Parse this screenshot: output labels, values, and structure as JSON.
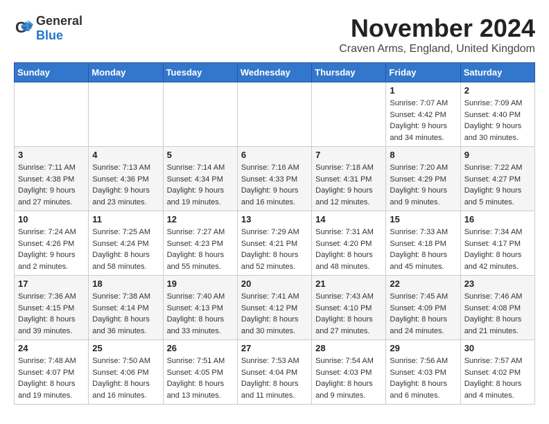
{
  "header": {
    "logo_general": "General",
    "logo_blue": "Blue",
    "month_title": "November 2024",
    "location": "Craven Arms, England, United Kingdom"
  },
  "weekdays": [
    "Sunday",
    "Monday",
    "Tuesday",
    "Wednesday",
    "Thursday",
    "Friday",
    "Saturday"
  ],
  "weeks": [
    [
      {
        "day": "",
        "info": ""
      },
      {
        "day": "",
        "info": ""
      },
      {
        "day": "",
        "info": ""
      },
      {
        "day": "",
        "info": ""
      },
      {
        "day": "",
        "info": ""
      },
      {
        "day": "1",
        "info": "Sunrise: 7:07 AM\nSunset: 4:42 PM\nDaylight: 9 hours\nand 34 minutes."
      },
      {
        "day": "2",
        "info": "Sunrise: 7:09 AM\nSunset: 4:40 PM\nDaylight: 9 hours\nand 30 minutes."
      }
    ],
    [
      {
        "day": "3",
        "info": "Sunrise: 7:11 AM\nSunset: 4:38 PM\nDaylight: 9 hours\nand 27 minutes."
      },
      {
        "day": "4",
        "info": "Sunrise: 7:13 AM\nSunset: 4:36 PM\nDaylight: 9 hours\nand 23 minutes."
      },
      {
        "day": "5",
        "info": "Sunrise: 7:14 AM\nSunset: 4:34 PM\nDaylight: 9 hours\nand 19 minutes."
      },
      {
        "day": "6",
        "info": "Sunrise: 7:16 AM\nSunset: 4:33 PM\nDaylight: 9 hours\nand 16 minutes."
      },
      {
        "day": "7",
        "info": "Sunrise: 7:18 AM\nSunset: 4:31 PM\nDaylight: 9 hours\nand 12 minutes."
      },
      {
        "day": "8",
        "info": "Sunrise: 7:20 AM\nSunset: 4:29 PM\nDaylight: 9 hours\nand 9 minutes."
      },
      {
        "day": "9",
        "info": "Sunrise: 7:22 AM\nSunset: 4:27 PM\nDaylight: 9 hours\nand 5 minutes."
      }
    ],
    [
      {
        "day": "10",
        "info": "Sunrise: 7:24 AM\nSunset: 4:26 PM\nDaylight: 9 hours\nand 2 minutes."
      },
      {
        "day": "11",
        "info": "Sunrise: 7:25 AM\nSunset: 4:24 PM\nDaylight: 8 hours\nand 58 minutes."
      },
      {
        "day": "12",
        "info": "Sunrise: 7:27 AM\nSunset: 4:23 PM\nDaylight: 8 hours\nand 55 minutes."
      },
      {
        "day": "13",
        "info": "Sunrise: 7:29 AM\nSunset: 4:21 PM\nDaylight: 8 hours\nand 52 minutes."
      },
      {
        "day": "14",
        "info": "Sunrise: 7:31 AM\nSunset: 4:20 PM\nDaylight: 8 hours\nand 48 minutes."
      },
      {
        "day": "15",
        "info": "Sunrise: 7:33 AM\nSunset: 4:18 PM\nDaylight: 8 hours\nand 45 minutes."
      },
      {
        "day": "16",
        "info": "Sunrise: 7:34 AM\nSunset: 4:17 PM\nDaylight: 8 hours\nand 42 minutes."
      }
    ],
    [
      {
        "day": "17",
        "info": "Sunrise: 7:36 AM\nSunset: 4:15 PM\nDaylight: 8 hours\nand 39 minutes."
      },
      {
        "day": "18",
        "info": "Sunrise: 7:38 AM\nSunset: 4:14 PM\nDaylight: 8 hours\nand 36 minutes."
      },
      {
        "day": "19",
        "info": "Sunrise: 7:40 AM\nSunset: 4:13 PM\nDaylight: 8 hours\nand 33 minutes."
      },
      {
        "day": "20",
        "info": "Sunrise: 7:41 AM\nSunset: 4:12 PM\nDaylight: 8 hours\nand 30 minutes."
      },
      {
        "day": "21",
        "info": "Sunrise: 7:43 AM\nSunset: 4:10 PM\nDaylight: 8 hours\nand 27 minutes."
      },
      {
        "day": "22",
        "info": "Sunrise: 7:45 AM\nSunset: 4:09 PM\nDaylight: 8 hours\nand 24 minutes."
      },
      {
        "day": "23",
        "info": "Sunrise: 7:46 AM\nSunset: 4:08 PM\nDaylight: 8 hours\nand 21 minutes."
      }
    ],
    [
      {
        "day": "24",
        "info": "Sunrise: 7:48 AM\nSunset: 4:07 PM\nDaylight: 8 hours\nand 19 minutes."
      },
      {
        "day": "25",
        "info": "Sunrise: 7:50 AM\nSunset: 4:06 PM\nDaylight: 8 hours\nand 16 minutes."
      },
      {
        "day": "26",
        "info": "Sunrise: 7:51 AM\nSunset: 4:05 PM\nDaylight: 8 hours\nand 13 minutes."
      },
      {
        "day": "27",
        "info": "Sunrise: 7:53 AM\nSunset: 4:04 PM\nDaylight: 8 hours\nand 11 minutes."
      },
      {
        "day": "28",
        "info": "Sunrise: 7:54 AM\nSunset: 4:03 PM\nDaylight: 8 hours\nand 9 minutes."
      },
      {
        "day": "29",
        "info": "Sunrise: 7:56 AM\nSunset: 4:03 PM\nDaylight: 8 hours\nand 6 minutes."
      },
      {
        "day": "30",
        "info": "Sunrise: 7:57 AM\nSunset: 4:02 PM\nDaylight: 8 hours\nand 4 minutes."
      }
    ]
  ]
}
